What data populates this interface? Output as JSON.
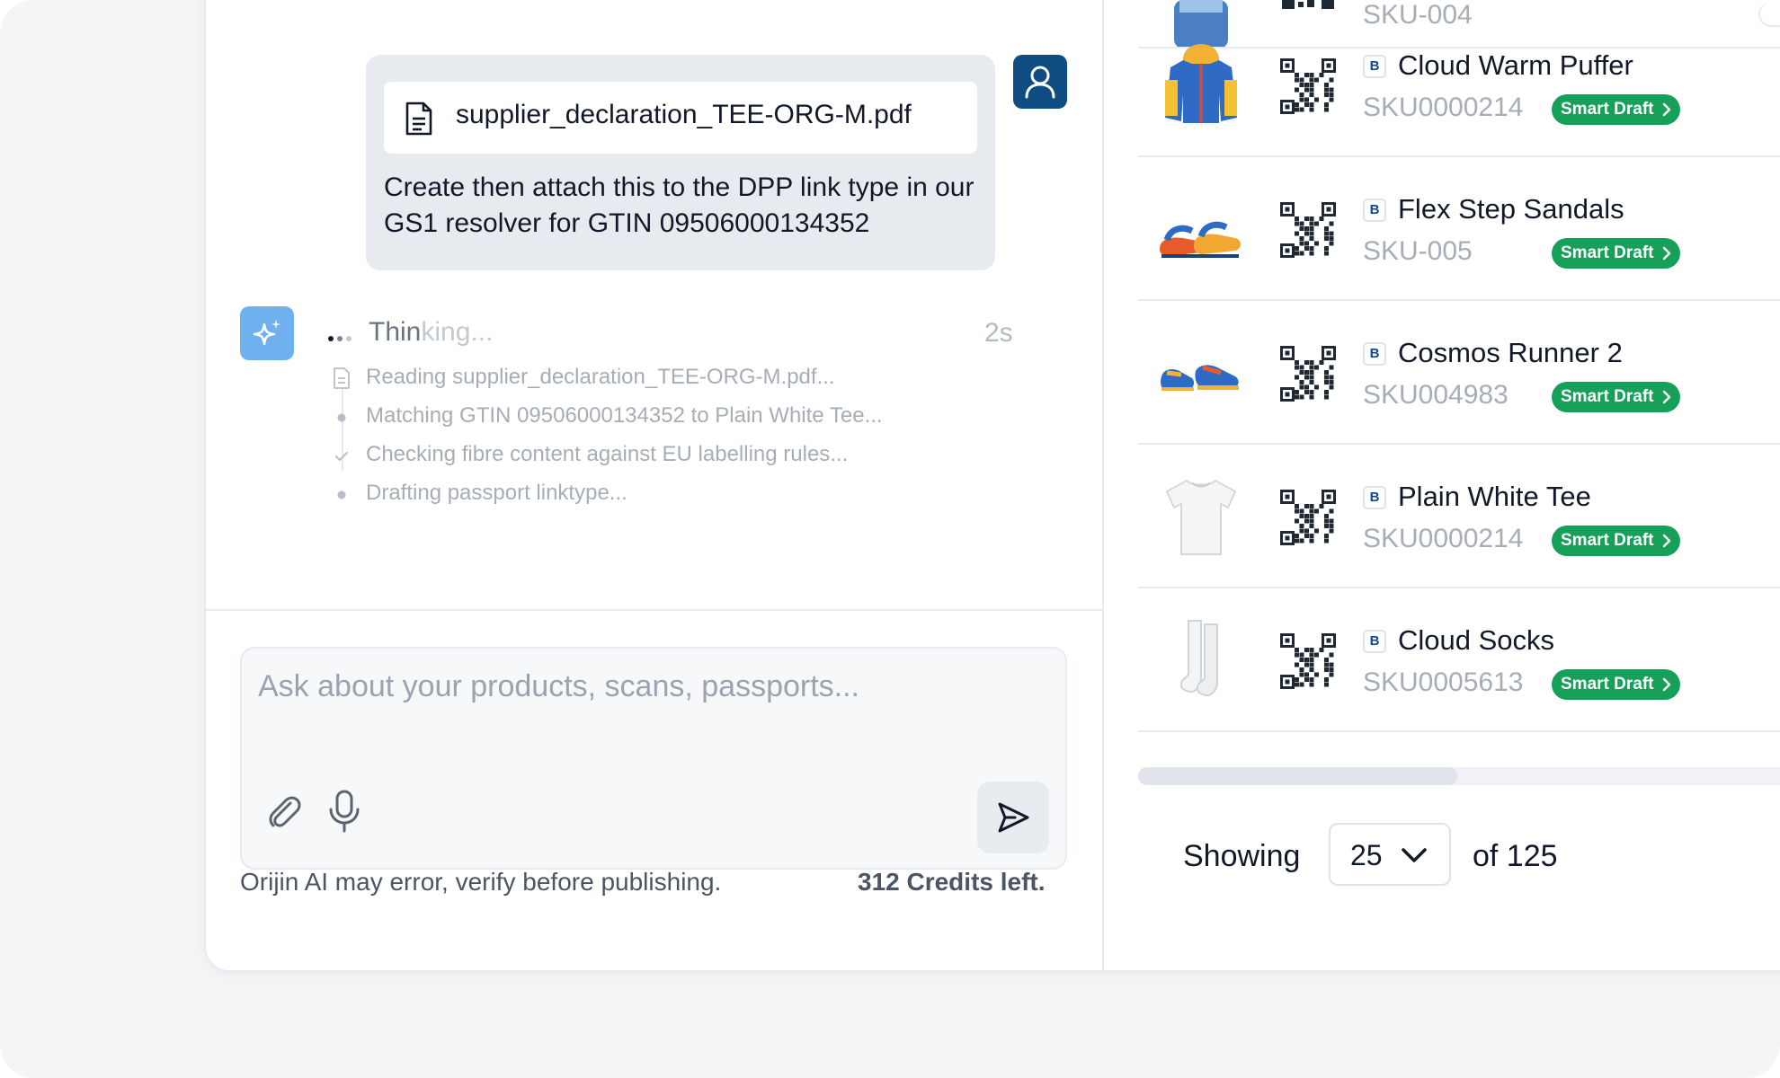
{
  "chat": {
    "attachment_name": "supplier_declaration_TEE-ORG-M.pdf",
    "user_message": "Create then attach this to the DPP link type in our GS1 resolver for GTIN 09506000134352",
    "thinking_label_solid": "Thin",
    "thinking_label_fade": "king...",
    "elapsed": "2s",
    "steps": [
      {
        "icon": "document-icon",
        "text": "Reading supplier_declaration_TEE-ORG-M.pdf..."
      },
      {
        "icon": "dot-icon",
        "text": "Matching GTIN 09506000134352 to Plain White Tee..."
      },
      {
        "icon": "check-icon",
        "text": "Checking fibre content against EU labelling rules..."
      },
      {
        "icon": "dot-icon",
        "text": "Drafting passport linktype..."
      }
    ]
  },
  "composer": {
    "placeholder": "Ask about your products, scans, passports...",
    "disclaimer": "Orijin AI may error, verify before publishing.",
    "credits": "312 Credits left."
  },
  "products": {
    "partial_top_sku": "SKU-004",
    "badge": "B",
    "action_label": "Smart Draft",
    "items": [
      {
        "name": "Cloud Warm Puffer",
        "sku": "SKU0000214",
        "thumb": "puffer-jacket"
      },
      {
        "name": "Flex Step Sandals",
        "sku": "SKU-005",
        "thumb": "sandals"
      },
      {
        "name": "Cosmos Runner 2",
        "sku": "SKU004983",
        "thumb": "sneakers"
      },
      {
        "name": "Plain White Tee",
        "sku": "SKU0000214",
        "thumb": "t-shirt"
      },
      {
        "name": "Cloud Socks",
        "sku": "SKU0005613",
        "thumb": "socks"
      }
    ],
    "pagination": {
      "showing_label": "Showing",
      "page_size": "25",
      "of_label": "of 125"
    }
  },
  "colors": {
    "brand_blue": "#0f4c81",
    "ai_blue": "#6fb1ee",
    "smart_green": "#16a05a"
  }
}
